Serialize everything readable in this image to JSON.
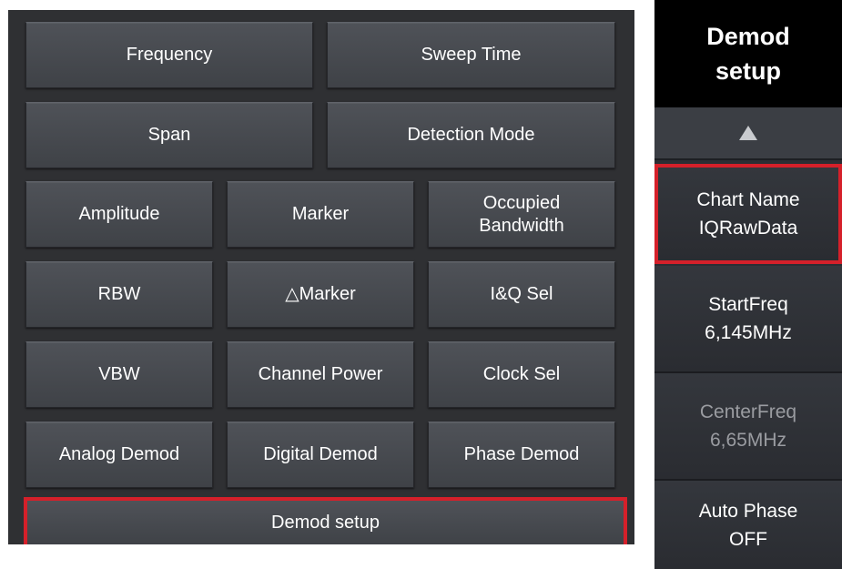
{
  "left_panel": {
    "buttons": [
      {
        "label": "Frequency"
      },
      {
        "label": "Sweep Time"
      },
      {
        "label": "Span"
      },
      {
        "label": "Detection Mode"
      },
      {
        "label": "Amplitude"
      },
      {
        "label": "Marker"
      },
      {
        "label": "Occupied\nBandwidth"
      },
      {
        "label": "RBW"
      },
      {
        "label": "△Marker"
      },
      {
        "label": "I&Q Sel"
      },
      {
        "label": "VBW"
      },
      {
        "label": "Channel Power"
      },
      {
        "label": "Clock Sel"
      },
      {
        "label": "Analog Demod"
      },
      {
        "label": "Digital Demod"
      },
      {
        "label": "Phase Demod"
      },
      {
        "label": "Demod setup",
        "selected": true
      }
    ]
  },
  "right_panel": {
    "title_line1": "Demod",
    "title_line2": "setup",
    "items": [
      {
        "line1": "Chart Name",
        "line2": "IQRawData",
        "selected": true
      },
      {
        "line1": "StartFreq",
        "line2": "6,145MHz"
      },
      {
        "line1": "CenterFreq",
        "line2": "6,65MHz",
        "disabled": true
      },
      {
        "line1": "Auto Phase",
        "line2": "OFF"
      }
    ]
  },
  "colors": {
    "highlight": "#d5202a",
    "panel_bg": "#2f3033",
    "button_bg": "#474a50"
  }
}
